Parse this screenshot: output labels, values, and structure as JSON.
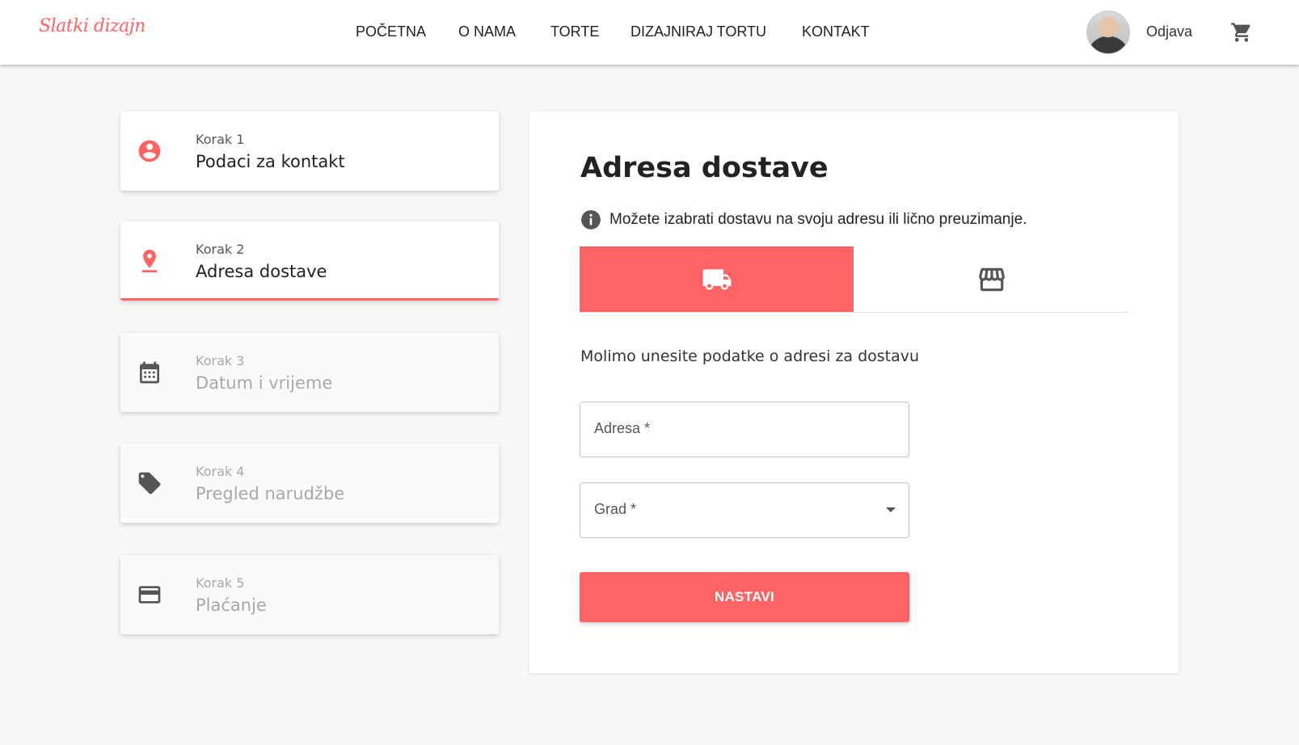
{
  "brand": {
    "logo_text": "Slatki dizajn",
    "accent_color": "#ff6363"
  },
  "nav": {
    "items": [
      {
        "label": "POČETNA"
      },
      {
        "label": "O NAMA"
      },
      {
        "label": "TORTE"
      },
      {
        "label": "DIZAJNIRAJ TORTU"
      },
      {
        "label": "KONTAKT"
      }
    ],
    "logout_label": "Odjava",
    "cart_icon": "shopping-cart-icon"
  },
  "steps": [
    {
      "number": "Korak 1",
      "title": "Podaci za kontakt",
      "icon": "account-circle-icon",
      "state": "completed"
    },
    {
      "number": "Korak 2",
      "title": "Adresa dostave",
      "icon": "location-pin-icon",
      "state": "active"
    },
    {
      "number": "Korak 3",
      "title": "Datum i vrijeme",
      "icon": "calendar-icon",
      "state": "disabled"
    },
    {
      "number": "Korak 4",
      "title": "Pregled narudžbe",
      "icon": "tag-icon",
      "state": "disabled"
    },
    {
      "number": "Korak 5",
      "title": "Plaćanje",
      "icon": "credit-card-icon",
      "state": "disabled"
    }
  ],
  "main": {
    "title": "Adresa dostave",
    "info_text": "Možete izabrati dostavu na svoju adresu ili lično preuzimanje.",
    "tabs": [
      {
        "icon": "delivery-truck-icon",
        "selected": true
      },
      {
        "icon": "store-icon",
        "selected": false
      }
    ],
    "hint": "Molimo unesite podatke o adresi za dostavu",
    "address_field": {
      "label": "Adresa *",
      "value": ""
    },
    "city_field": {
      "label": "Grad *",
      "value": ""
    },
    "continue_button": "NASTAVI"
  }
}
